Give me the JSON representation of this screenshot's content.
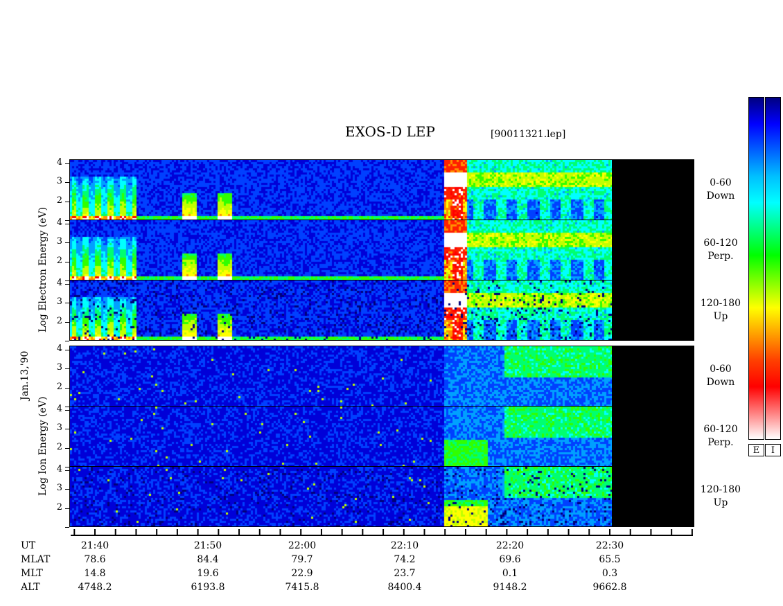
{
  "chart_data": {
    "type": "heatmap",
    "title": "EXOS-D LEP",
    "file": "[90011321.lep]",
    "date_label": "Jan.13,'90",
    "electron_axis_label": "Log Electron Energy (eV)",
    "ion_axis_label": "Log Ion Energy (eV)",
    "y_ticks": [
      "1",
      "2",
      "3",
      "4"
    ],
    "ylim": [
      1,
      4.2
    ],
    "x_ticks": [
      "21:40",
      "21:50",
      "22:00",
      "22:10",
      "22:20",
      "22:30"
    ],
    "x_unit_label": "UT",
    "panels": [
      {
        "species": "Electron",
        "pitch": "0-60",
        "direction": "Down"
      },
      {
        "species": "Electron",
        "pitch": "60-120",
        "direction": "Perp."
      },
      {
        "species": "Electron",
        "pitch": "120-180",
        "direction": "Up"
      },
      {
        "species": "Ion",
        "pitch": "0-60",
        "direction": "Down"
      },
      {
        "species": "Ion",
        "pitch": "60-120",
        "direction": "Perp."
      },
      {
        "species": "Ion",
        "pitch": "120-180",
        "direction": "Up"
      }
    ],
    "ephemeris": [
      {
        "name": "MLAT",
        "values": [
          "78.6",
          "84.4",
          "79.7",
          "74.2",
          "69.6",
          "65.5"
        ]
      },
      {
        "name": "MLT",
        "values": [
          "14.8",
          "19.6",
          "22.9",
          "23.7",
          "0.1",
          "0.3"
        ]
      },
      {
        "name": "ALT",
        "values": [
          "4748.2",
          "6193.8",
          "7415.8",
          "8400.4",
          "9148.2",
          "9662.8"
        ]
      }
    ],
    "colorbars": [
      {
        "label": "E"
      },
      {
        "label": "I"
      }
    ],
    "colormap": [
      "#000080",
      "#0000ff",
      "#0080ff",
      "#00ffff",
      "#00ff80",
      "#00ff00",
      "#80ff00",
      "#ffff00",
      "#ff8000",
      "#ff0000",
      "#ffffff"
    ]
  }
}
